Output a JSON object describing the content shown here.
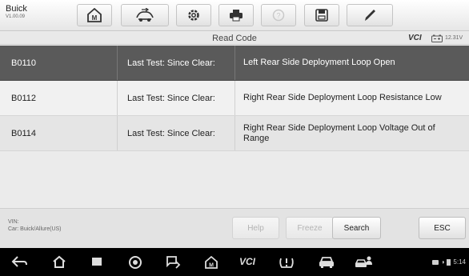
{
  "vehicle": {
    "make": "Buick",
    "version": "V1.00.09"
  },
  "toolbar": {
    "items": [
      {
        "name": "home-icon"
      },
      {
        "name": "vehicle-swap-icon"
      },
      {
        "name": "settings-icon"
      },
      {
        "name": "print-icon"
      },
      {
        "name": "help-icon",
        "disabled": true
      },
      {
        "name": "save-icon"
      },
      {
        "name": "pen-icon"
      }
    ]
  },
  "header": {
    "title": "Read Code",
    "vci_label": "VCI",
    "battery_voltage": "12.31V"
  },
  "codes": [
    {
      "code": "B0110",
      "test": "Last Test: Since Clear:",
      "description": "Left Rear Side Deployment Loop Open",
      "selected": true
    },
    {
      "code": "B0112",
      "test": "Last Test: Since Clear:",
      "description": "Right Rear Side Deployment Loop Resistance Low",
      "selected": false
    },
    {
      "code": "B0114",
      "test": "Last Test: Since Clear:",
      "description": "Right Rear Side Deployment Loop Voltage Out of Range",
      "selected": false
    }
  ],
  "info": {
    "vin_label": "VIN:",
    "car_label": "Car: Buick/Allure(US)"
  },
  "buttons": {
    "help": "Help",
    "freeze": "Freeze",
    "search": "Search",
    "esc": "ESC"
  },
  "navbar": {
    "icons": [
      "back-icon",
      "home-icon",
      "recent-apps-icon",
      "browser-icon",
      "screenshot-icon",
      "maxisys-icon",
      "vci-icon",
      "tpms-icon",
      "car-icon",
      "car-person-icon"
    ],
    "status_time": "5:14"
  },
  "colors": {
    "selected_row": "#5a5a5a",
    "accent_vci": "#333333"
  }
}
